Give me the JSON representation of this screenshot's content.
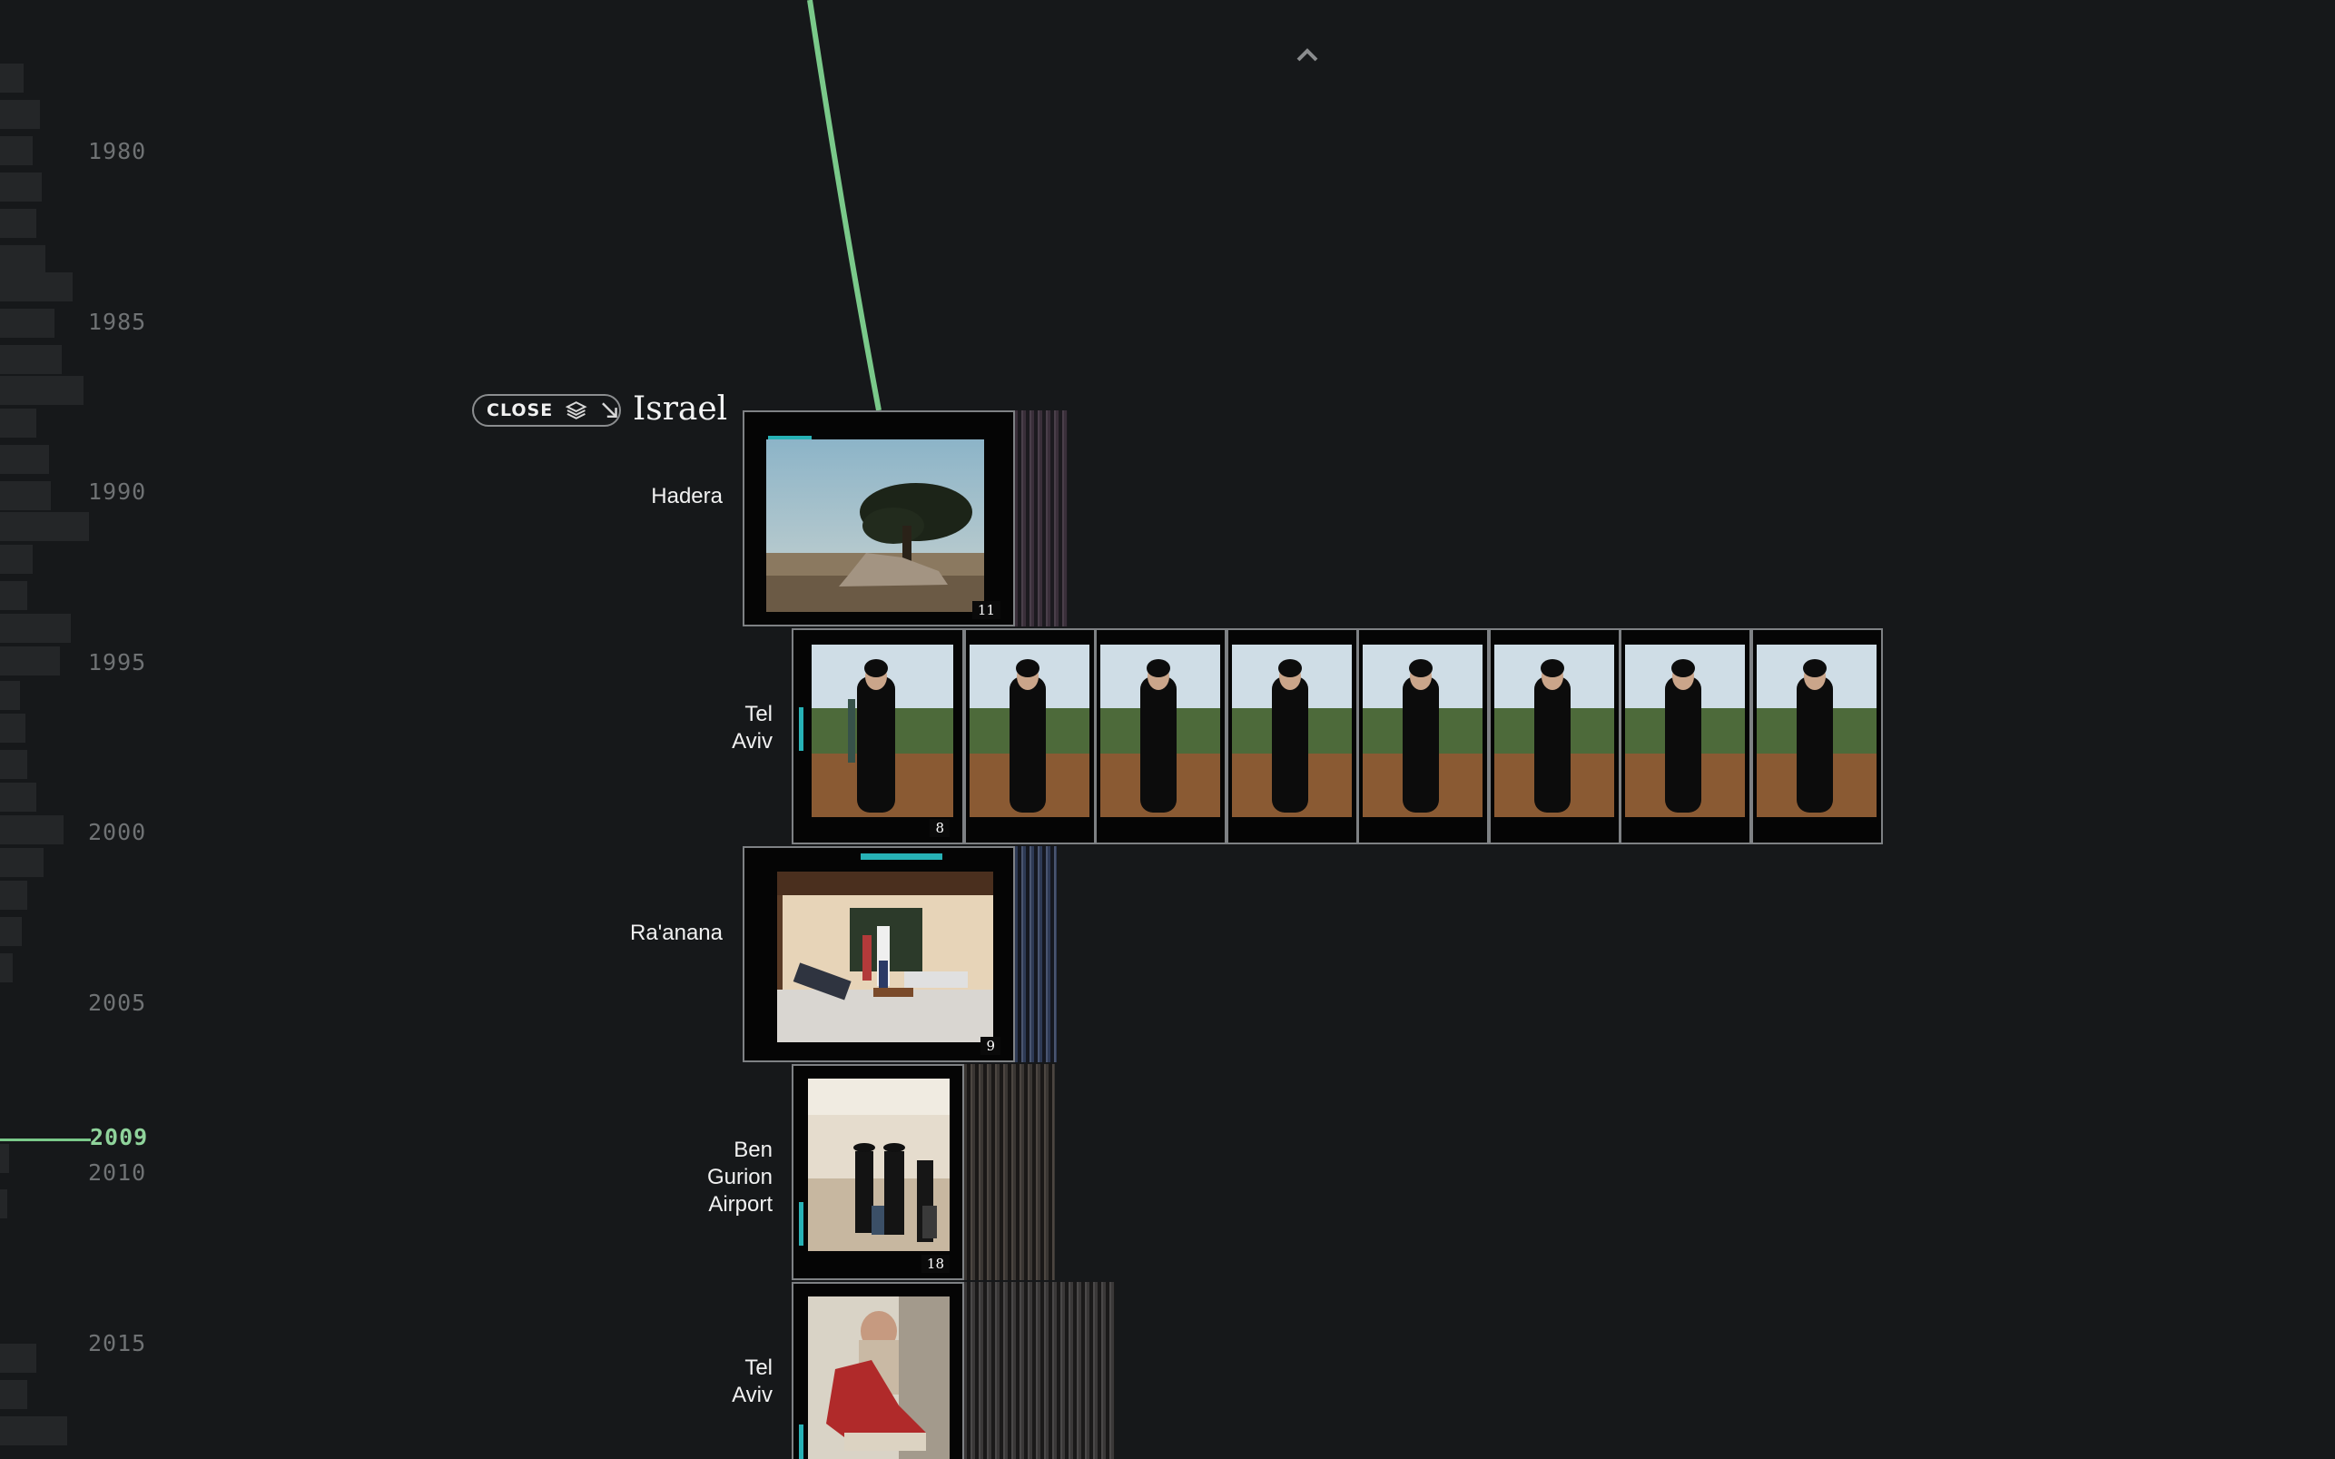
{
  "timeline": {
    "years": [
      "1980",
      "1985",
      "1990",
      "1995",
      "2000",
      "2005",
      "2010",
      "2015"
    ],
    "current_year": "2009"
  },
  "group": {
    "close_label": "CLOSE",
    "country": "Israel"
  },
  "locations": [
    {
      "name_lines": [
        "Hadera"
      ],
      "count": "11"
    },
    {
      "name_lines": [
        "Tel",
        "Aviv"
      ],
      "count": "8"
    },
    {
      "name_lines": [
        "Ra'anana"
      ],
      "count": "9"
    },
    {
      "name_lines": [
        "Ben",
        "Gurion",
        "Airport"
      ],
      "count": "18"
    },
    {
      "name_lines": [
        "Tel",
        "Aviv"
      ],
      "count": ""
    }
  ],
  "icons": [
    "chevron-up-icon",
    "layers-icon",
    "arrow-down-right-icon"
  ],
  "colors": {
    "accent": "#7ac98a",
    "background": "#16181a",
    "timeline_bar": "#242628"
  }
}
